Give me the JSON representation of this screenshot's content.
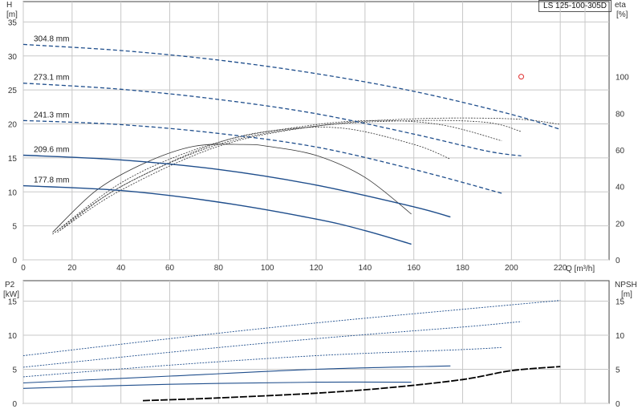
{
  "title": "LS 125-100-305D",
  "top_left_axis": {
    "name": "H",
    "unit": "[m]"
  },
  "top_right_axis": {
    "name": "eta",
    "unit": "[%]"
  },
  "bottom_left_axis": {
    "name": "P2",
    "unit": "[kW]"
  },
  "bottom_right_axis": {
    "name": "NPSH",
    "unit": "[m]"
  },
  "x_axis_label": "Q [m³/h]",
  "colors": {
    "head": "#1f4e8c",
    "dashed": "#1f4e8c",
    "eff": "#333333",
    "npsh": "#000000",
    "marker": "#e03030",
    "grid": "#c8c8c8"
  },
  "chart_data": [
    {
      "type": "line",
      "name": "head_efficiency",
      "xlim": [
        0,
        240
      ],
      "x_ticks": [
        0,
        20,
        40,
        60,
        80,
        100,
        120,
        140,
        160,
        180,
        200,
        220
      ],
      "ylim": [
        0,
        38
      ],
      "y_ticks": [
        0,
        5,
        10,
        15,
        20,
        25,
        30,
        35
      ],
      "eta_lim": [
        0,
        141
      ],
      "eta_ticks": [
        0,
        20,
        40,
        60,
        80,
        100
      ],
      "head_curves": [
        {
          "name": "304.8 mm",
          "x": [
            0,
            40,
            80,
            120,
            160,
            200,
            220
          ],
          "y": [
            31.7,
            30.8,
            29.4,
            27.4,
            24.8,
            21.4,
            19.2
          ]
        },
        {
          "name": "273.1 mm",
          "x": [
            0,
            40,
            80,
            120,
            160,
            190,
            204
          ],
          "y": [
            26.0,
            25.1,
            23.6,
            21.5,
            18.5,
            16.0,
            15.3
          ]
        },
        {
          "name": "241.3 mm",
          "x": [
            0,
            40,
            80,
            120,
            160,
            196
          ],
          "y": [
            20.5,
            19.9,
            18.6,
            16.6,
            13.3,
            9.8
          ]
        },
        {
          "name": "209.6 mm",
          "x": [
            0,
            40,
            80,
            120,
            160,
            175
          ],
          "y": [
            15.4,
            14.7,
            13.3,
            11.0,
            7.8,
            6.3
          ]
        },
        {
          "name": "177.8 mm",
          "x": [
            0,
            40,
            80,
            120,
            140,
            159
          ],
          "y": [
            10.9,
            10.2,
            8.5,
            6.0,
            4.3,
            2.3
          ]
        }
      ],
      "efficiency_curves": [
        {
          "x": [
            12,
            30,
            50,
            70,
            90,
            100,
            120,
            140,
            159
          ],
          "y": [
            15,
            38,
            53,
            62,
            63,
            62,
            57,
            45,
            25
          ]
        },
        {
          "x": [
            12,
            40,
            70,
            100,
            130,
            160,
            175
          ],
          "y": [
            14,
            42,
            60,
            70,
            72,
            63,
            55
          ]
        },
        {
          "x": [
            13,
            40,
            80,
            110,
            140,
            170,
            196
          ],
          "y": [
            15,
            40,
            64,
            72,
            76,
            74,
            65
          ]
        },
        {
          "x": [
            14,
            40,
            80,
            120,
            160,
            190,
            204
          ],
          "y": [
            15,
            40,
            63,
            73,
            76,
            75,
            70
          ]
        },
        {
          "x": [
            15,
            40,
            80,
            120,
            160,
            200,
            220
          ],
          "y": [
            16,
            38,
            62,
            73,
            77,
            77,
            74
          ]
        }
      ],
      "marker": {
        "x": 204,
        "eta": 100
      }
    },
    {
      "type": "line",
      "name": "power_npsh",
      "xlim": [
        0,
        240
      ],
      "ylim": [
        0,
        18
      ],
      "y_ticks": [
        0,
        5,
        10,
        15
      ],
      "power_curves": [
        {
          "x": [
            0,
            60,
            120,
            180,
            220
          ],
          "y": [
            7.0,
            9.5,
            11.8,
            13.8,
            15.1
          ]
        },
        {
          "x": [
            0,
            60,
            120,
            180,
            204
          ],
          "y": [
            5.3,
            7.5,
            9.5,
            11.2,
            12.0
          ]
        },
        {
          "x": [
            0,
            60,
            120,
            180,
            196
          ],
          "y": [
            3.9,
            5.6,
            7.0,
            7.9,
            8.2
          ]
        },
        {
          "x": [
            0,
            60,
            120,
            175
          ],
          "y": [
            3.0,
            4.0,
            5.0,
            5.5
          ]
        },
        {
          "x": [
            0,
            60,
            120,
            159
          ],
          "y": [
            2.2,
            2.8,
            3.1,
            3.1
          ]
        }
      ],
      "npsh_curve": {
        "x": [
          49,
          80,
          120,
          150,
          180,
          200,
          220
        ],
        "y": [
          0.4,
          0.8,
          1.5,
          2.3,
          3.5,
          4.8,
          5.4
        ]
      }
    }
  ]
}
